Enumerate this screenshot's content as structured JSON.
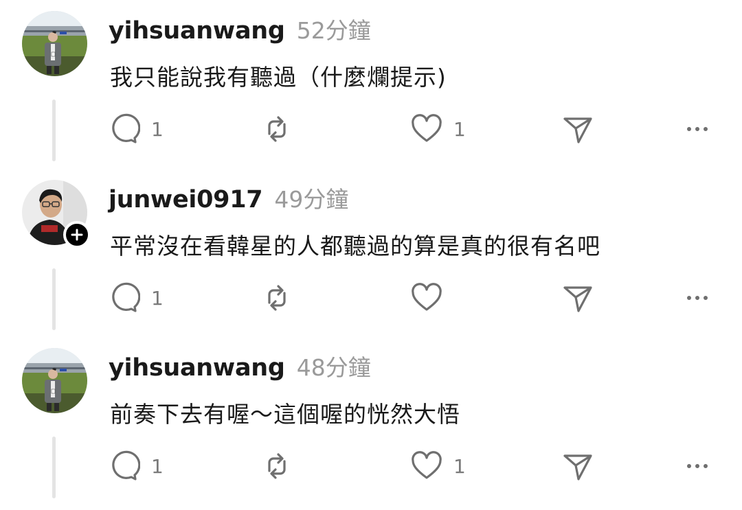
{
  "posts": [
    {
      "username": "yihsuanwang",
      "time": "52分鐘",
      "text": "我只能說我有聽過（什麼爛提示)",
      "reply_count": "1",
      "like_count": "1",
      "avatar": "stadium-photo",
      "show_follow": false
    },
    {
      "username": "junwei0917",
      "time": "49分鐘",
      "text": "平常沒在看韓星的人都聽過的算是真的很有名吧",
      "reply_count": "1",
      "like_count": "",
      "avatar": "portrait-photo",
      "show_follow": true
    },
    {
      "username": "yihsuanwang",
      "time": "48分鐘",
      "text": "前奏下去有喔～這個喔的恍然大悟",
      "reply_count": "1",
      "like_count": "1",
      "avatar": "stadium-photo",
      "show_follow": false
    }
  ],
  "icons": {
    "reply": "speech-bubble-icon",
    "repost": "repost-arrows-icon",
    "like": "heart-icon",
    "share": "paper-plane-icon",
    "more": "ellipsis-icon",
    "follow": "plus-icon"
  },
  "colors": {
    "text": "#1a1a1a",
    "muted": "#9a9a9a",
    "icon": "#6f6f6f",
    "thread_line": "#e4e4e4"
  }
}
